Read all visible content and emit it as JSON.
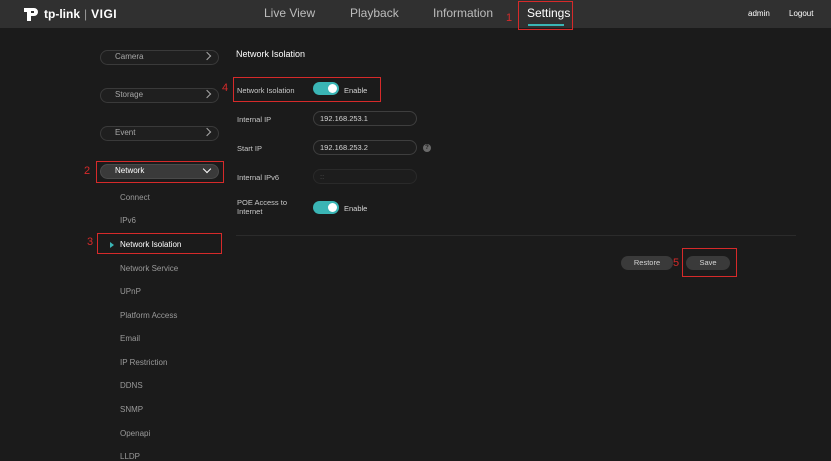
{
  "header": {
    "brand": "tp-link",
    "product": "VIGI",
    "nav": [
      "Live View",
      "Playback",
      "Information",
      "Settings"
    ],
    "active_nav": "Settings",
    "user": "admin",
    "logout": "Logout"
  },
  "sidebar": {
    "groups": [
      "Camera",
      "Storage",
      "Event",
      "Network"
    ],
    "network_items": [
      "Connect",
      "IPv6",
      "Network Isolation",
      "Network Service",
      "UPnP",
      "Platform Access",
      "Email",
      "IP Restriction",
      "DDNS",
      "SNMP",
      "Openapi",
      "LLDP"
    ],
    "active_item": "Network Isolation"
  },
  "content": {
    "title": "Network Isolation",
    "network_isolation": {
      "label": "Network Isolation",
      "enabled": true,
      "text": "Enable"
    },
    "internal_ip": {
      "label": "Internal IP",
      "value": "192.168.253.1"
    },
    "start_ip": {
      "label": "Start IP",
      "value": "192.168.253.2",
      "help": "?"
    },
    "internal_ipv6": {
      "label": "Internal IPv6",
      "value": "::"
    },
    "poe_access": {
      "label": "POE Access to Internet",
      "enabled": true,
      "text": "Enable"
    },
    "restore_label": "Restore",
    "save_label": "Save"
  },
  "callouts": [
    "1",
    "2",
    "3",
    "4",
    "5"
  ],
  "colors": {
    "accent": "#3ab5b5",
    "callout": "#d62a2a",
    "header_bg": "#303030",
    "page_bg": "#1b1b1b"
  }
}
